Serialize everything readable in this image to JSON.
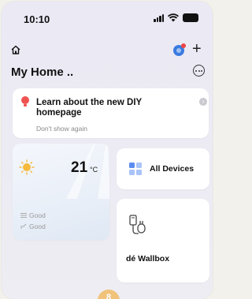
{
  "status_bar": {
    "time": "10:10",
    "battery": ""
  },
  "header": {
    "title": "My Home .."
  },
  "banner": {
    "title": "Learn about the new DIY homepage",
    "dismiss": "Don't show again"
  },
  "weather": {
    "temperature": "21",
    "unit": "°C",
    "air_quality": "Good",
    "humidity": "Good"
  },
  "cards": {
    "all_devices": "All Devices",
    "wallbox": "dé Wallbox"
  },
  "icons": [
    "home-icon",
    "avatar",
    "add-icon",
    "more-icon",
    "bulb-icon",
    "close-icon",
    "sun-icon",
    "devices-icon",
    "plug-icon"
  ],
  "colors": {
    "accent": "#f0c27a",
    "bulb": "#ef5350",
    "devices": "#5b8def"
  }
}
